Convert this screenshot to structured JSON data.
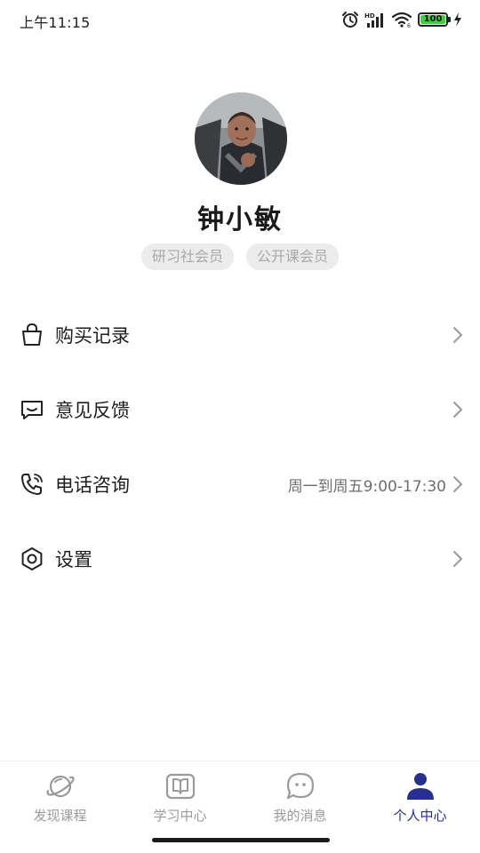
{
  "status_bar": {
    "time": "上午11:15",
    "battery": "100",
    "network_label": "HD",
    "wifi_badge": "6",
    "colors": {
      "battery_fill": "#3ecf3e"
    },
    "icons": [
      "alarm-icon",
      "signal-icon",
      "wifi-icon",
      "battery-icon",
      "charging-icon"
    ]
  },
  "profile": {
    "name": "钟小敏",
    "badges": [
      "研习社会员",
      "公开课会员"
    ]
  },
  "menu": {
    "items": [
      {
        "label": "购买记录",
        "icon": "shopping-bag-icon",
        "extra": ""
      },
      {
        "label": "意见反馈",
        "icon": "feedback-icon",
        "extra": ""
      },
      {
        "label": "电话咨询",
        "icon": "phone-icon",
        "extra": "周一到周五9:00-17:30"
      },
      {
        "label": "设置",
        "icon": "settings-icon",
        "extra": ""
      }
    ]
  },
  "bottom_nav": {
    "items": [
      {
        "label": "发现课程",
        "icon": "planet-icon",
        "active": false
      },
      {
        "label": "学习中心",
        "icon": "book-icon",
        "active": false
      },
      {
        "label": "我的消息",
        "icon": "message-icon",
        "active": false
      },
      {
        "label": "个人中心",
        "icon": "person-icon",
        "active": true
      }
    ],
    "colors": {
      "active": "#27308f",
      "inactive": "#9a9a9a"
    }
  }
}
